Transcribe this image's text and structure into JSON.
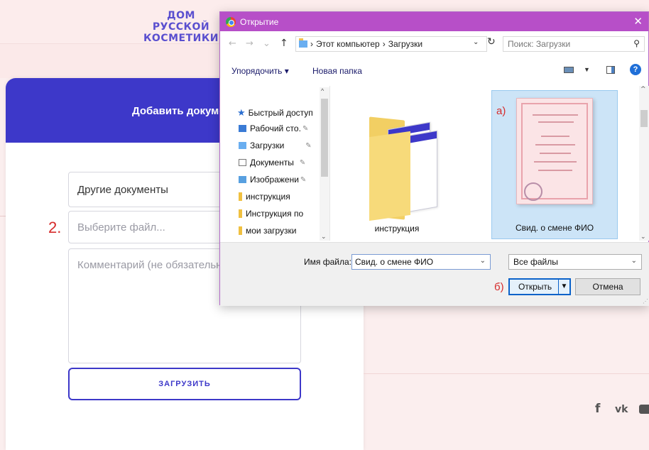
{
  "site": {
    "logo_line1": "ДОМ РУССКОЙ",
    "logo_line2": "КОСМЕТИКИ",
    "card_title": "Добавить документ",
    "doc_type_value": "Другие документы",
    "file_placeholder": "Выберите файл...",
    "comment_placeholder": "Комментарий (не обязательно)",
    "upload_label": "ЗАГРУЗИТЬ",
    "step_marker": "2.",
    "social": {
      "facebook": "f",
      "vk": "vk"
    }
  },
  "dialog": {
    "title": "Открытие",
    "close_glyph": "✕",
    "nav": {
      "back": "←",
      "forward": "→",
      "recent": "⌄",
      "up": "↑",
      "refresh": "↻"
    },
    "path": {
      "root": "Этот компьютер",
      "separator": "›",
      "folder": "Загрузки"
    },
    "search_placeholder": "Поиск: Загрузки",
    "toolbar": {
      "organize": "Упорядочить ▾",
      "new_folder": "Новая папка",
      "help": "?"
    },
    "nav_items": [
      {
        "label": "Быстрый доступ",
        "icon": "star",
        "pinned": false
      },
      {
        "label": "Рабочий сто.",
        "icon": "desk",
        "pinned": true
      },
      {
        "label": "Загрузки",
        "icon": "dl",
        "pinned": true
      },
      {
        "label": "Документы",
        "icon": "doc",
        "pinned": true
      },
      {
        "label": "Изображени",
        "icon": "img",
        "pinned": true
      },
      {
        "label": "инструкция",
        "icon": "folder",
        "pinned": false
      },
      {
        "label": "Инструкция по",
        "icon": "folder",
        "pinned": false
      },
      {
        "label": "мои загрузки",
        "icon": "folder",
        "pinned": false
      }
    ],
    "files": [
      {
        "label": "инструкция",
        "type": "folder",
        "selected": false
      },
      {
        "label": "Свид. о смене ФИО",
        "type": "image",
        "selected": true,
        "marker": "а)"
      }
    ],
    "filename_label": "Имя файла:",
    "filename_value": "Свид. о смене ФИО",
    "filter_value": "Все файлы",
    "open_label": "Открыть",
    "cancel_label": "Отмена",
    "open_marker": "б)"
  },
  "colors": {
    "brand": "#3d38c9",
    "titlebar": "#b74fc8",
    "annotation": "#d62b2b"
  }
}
